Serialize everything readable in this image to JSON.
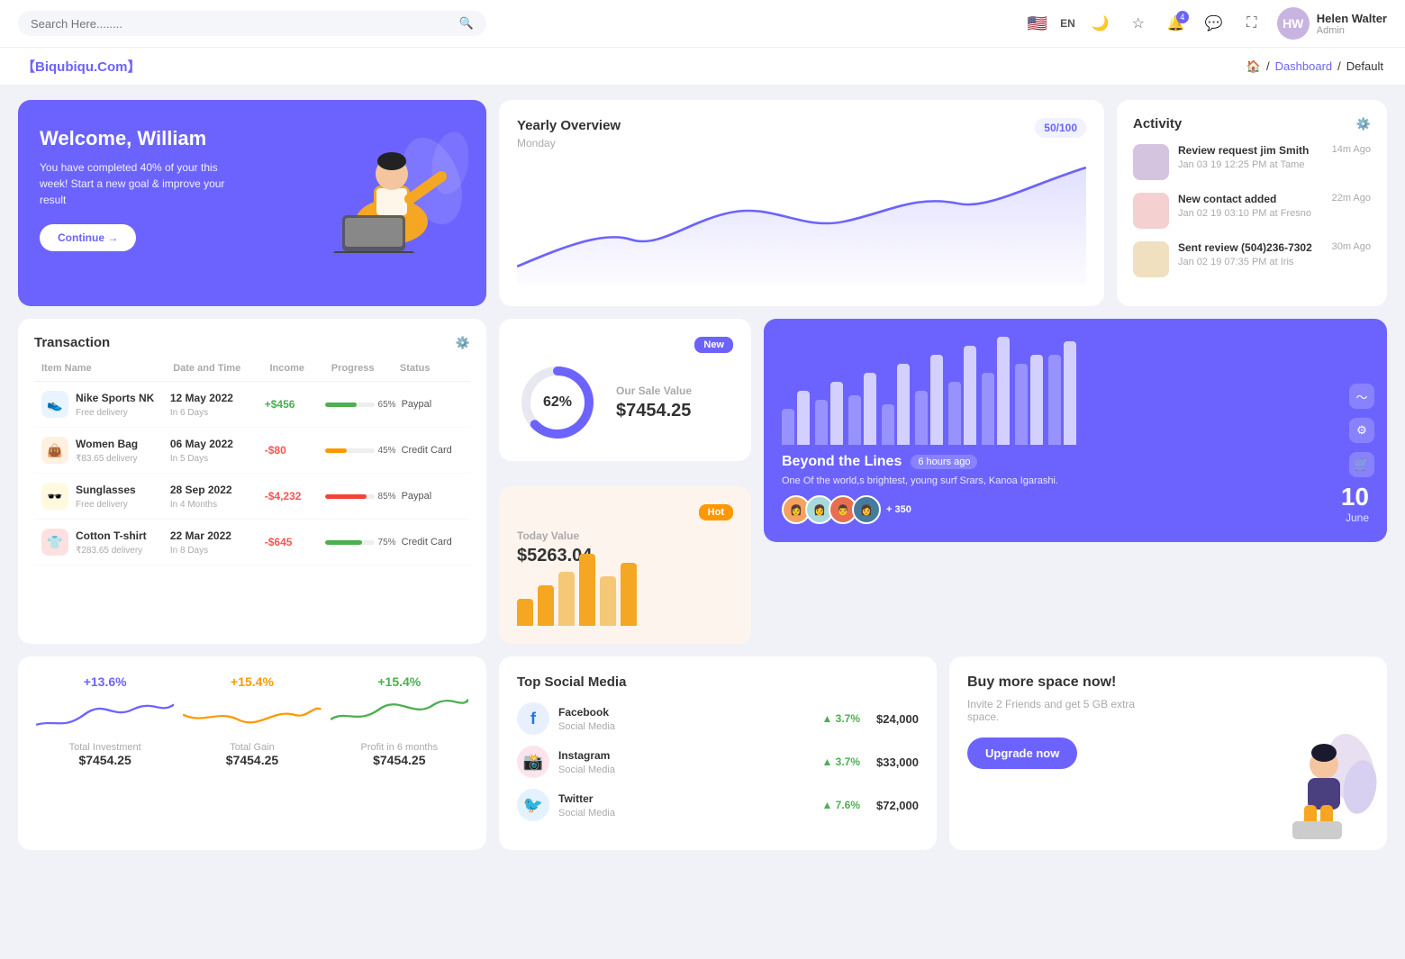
{
  "topnav": {
    "search_placeholder": "Search Here........",
    "lang": "EN",
    "user_name": "Helen Walter",
    "user_role": "Admin",
    "user_initials": "HW",
    "notification_count": "4"
  },
  "breadcrumb": {
    "logo": "【Biqubiqu.Com】",
    "home": "Home",
    "dashboard": "Dashboard",
    "current": "Default"
  },
  "welcome": {
    "title": "Welcome, William",
    "subtitle": "You have completed 40% of your this week! Start a new goal & improve your result",
    "button": "Continue →"
  },
  "yearly": {
    "title": "Yearly Overview",
    "subtitle": "Monday",
    "score": "50/100"
  },
  "activity": {
    "title": "Activity",
    "items": [
      {
        "title": "Review request jim Smith",
        "detail": "Jan 03 19 12:25 PM at Tame",
        "time": "14m Ago",
        "color": "#d4c4e0"
      },
      {
        "title": "New contact added",
        "detail": "Jan 02 19 03:10 PM at Fresno",
        "time": "22m Ago",
        "color": "#f4d0d0"
      },
      {
        "title": "Sent review (504)236-7302",
        "detail": "Jan 02 19 07:35 PM at Iris",
        "time": "30m Ago",
        "color": "#f0e0c0"
      }
    ]
  },
  "transaction": {
    "title": "Transaction",
    "columns": [
      "Item Name",
      "Date and Time",
      "Income",
      "Progress",
      "Status"
    ],
    "rows": [
      {
        "name": "Nike Sports NK",
        "delivery": "Free delivery",
        "date": "12 May 2022",
        "days": "In 6 Days",
        "income": "+$456",
        "income_pos": true,
        "progress": 65,
        "progress_color": "#4caf50",
        "status": "Paypal",
        "icon": "👟",
        "icon_bg": "#e8f4ff"
      },
      {
        "name": "Women Bag",
        "delivery": "₹83.65 delivery",
        "date": "06 May 2022",
        "days": "In 5 Days",
        "income": "-$80",
        "income_pos": false,
        "progress": 45,
        "progress_color": "#ff9800",
        "status": "Credit Card",
        "icon": "👜",
        "icon_bg": "#fff0e0"
      },
      {
        "name": "Sunglasses",
        "delivery": "Free delivery",
        "date": "28 Sep 2022",
        "days": "In 4 Months",
        "income": "-$4,232",
        "income_pos": false,
        "progress": 85,
        "progress_color": "#f44336",
        "status": "Paypal",
        "icon": "🕶️",
        "icon_bg": "#fff9e0"
      },
      {
        "name": "Cotton T-shirt",
        "delivery": "₹283.65 delivery",
        "date": "22 Mar 2022",
        "days": "In 8 Days",
        "income": "-$645",
        "income_pos": false,
        "progress": 75,
        "progress_color": "#4caf50",
        "status": "Credit Card",
        "icon": "👕",
        "icon_bg": "#ffe0e0"
      }
    ]
  },
  "sale_value": {
    "badge": "New",
    "percentage": "62%",
    "label": "Our Sale Value",
    "amount": "$7454.25"
  },
  "today_value": {
    "badge": "Hot",
    "label": "Today Value",
    "amount": "$5263.04",
    "bars": [
      30,
      45,
      60,
      80,
      55,
      70
    ]
  },
  "beyond": {
    "title": "Beyond the Lines",
    "time": "6 hours ago",
    "description": "One Of the world,s brightest, young surf Srars, Kanoa Igarashi.",
    "extra": "+ 350",
    "date_num": "10",
    "date_month": "June",
    "bars": [
      {
        "h1": 40,
        "h2": 60
      },
      {
        "h1": 50,
        "h2": 70
      },
      {
        "h1": 55,
        "h2": 80
      },
      {
        "h1": 45,
        "h2": 90
      },
      {
        "h1": 60,
        "h2": 100
      },
      {
        "h1": 70,
        "h2": 110
      },
      {
        "h1": 80,
        "h2": 120
      },
      {
        "h1": 90,
        "h2": 100
      },
      {
        "h1": 100,
        "h2": 115
      }
    ]
  },
  "metrics": [
    {
      "pct": "+13.6%",
      "color": "purple",
      "label": "Total Investment",
      "value": "$7454.25"
    },
    {
      "pct": "+15.4%",
      "color": "orange",
      "label": "Total Gain",
      "value": "$7454.25"
    },
    {
      "pct": "+15.4%",
      "color": "green",
      "label": "Profit in 6 months",
      "value": "$7454.25"
    }
  ],
  "social": {
    "title": "Top Social Media",
    "items": [
      {
        "name": "Facebook",
        "category": "Social Media",
        "pct": "3.7%",
        "amount": "$24,000",
        "icon": "f",
        "color": "#1877f2"
      },
      {
        "name": "Instagram",
        "category": "Social Media",
        "pct": "3.7%",
        "amount": "$33,000",
        "icon": "📸",
        "color": "#e1306c"
      },
      {
        "name": "Twitter",
        "category": "Social Media",
        "pct": "7.6%",
        "amount": "$72,000",
        "icon": "🐦",
        "color": "#1da1f2"
      }
    ]
  },
  "upgrade": {
    "title": "Buy more space now!",
    "description": "Invite 2 Friends and get 5 GB extra space.",
    "button": "Upgrade now"
  }
}
